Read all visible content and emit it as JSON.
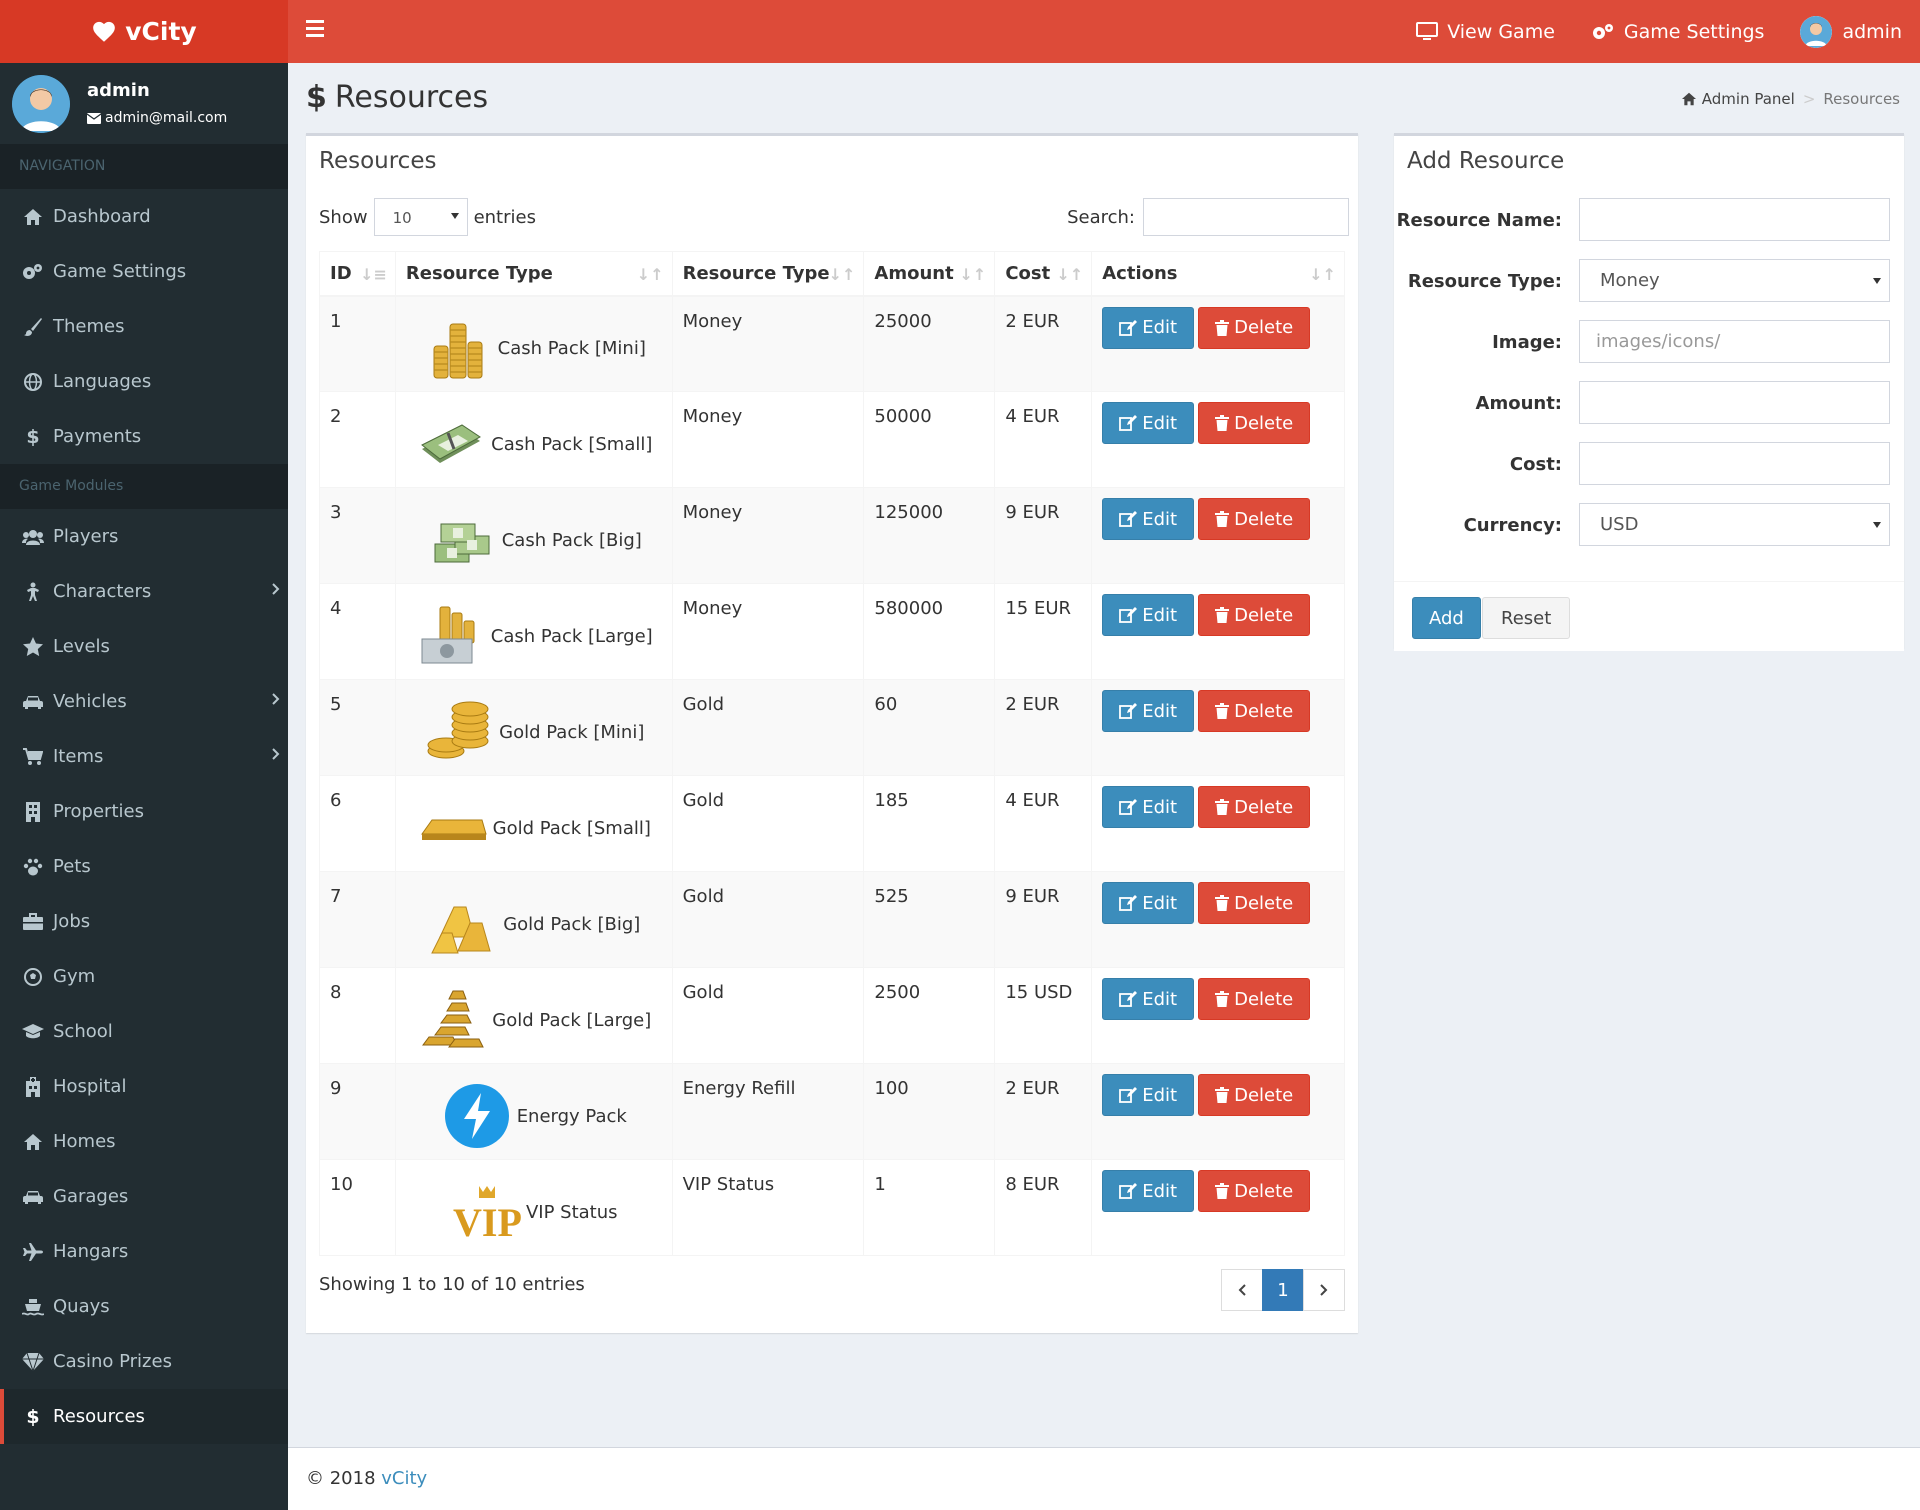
{
  "app": {
    "name": "vCity"
  },
  "topnav": {
    "view_game": "View Game",
    "game_settings": "Game Settings",
    "user": "admin"
  },
  "sidebar": {
    "user_name": "admin",
    "user_email": "admin@mail.com",
    "header_nav": "NAVIGATION",
    "header_modules": "Game Modules",
    "nav": [
      "Dashboard",
      "Game Settings",
      "Themes",
      "Languages",
      "Payments"
    ],
    "modules": [
      "Players",
      "Characters",
      "Levels",
      "Vehicles",
      "Items",
      "Properties",
      "Pets",
      "Jobs",
      "Gym",
      "School",
      "Hospital",
      "Homes",
      "Garages",
      "Hangars",
      "Quays",
      "Casino Prizes",
      "Resources"
    ]
  },
  "page": {
    "title": "Resources"
  },
  "breadcrumb": {
    "home": "Admin Panel",
    "current": "Resources"
  },
  "table_box": {
    "title": "Resources",
    "show": "Show",
    "entries": "entries",
    "page_length": "10",
    "search_label": "Search:",
    "search_value": "",
    "columns": [
      "ID",
      "Resource Type",
      "Resource Type",
      "Amount",
      "Cost",
      "Actions"
    ],
    "edit_label": "Edit",
    "delete_label": "Delete",
    "rows": [
      {
        "id": "1",
        "name": "Cash Pack [Mini]",
        "type": "Money",
        "amount": "25000",
        "cost": "2 EUR",
        "icon": "coin-stacks-icon"
      },
      {
        "id": "2",
        "name": "Cash Pack [Small]",
        "type": "Money",
        "amount": "50000",
        "cost": "4 EUR",
        "icon": "banknote-bundle-icon"
      },
      {
        "id": "3",
        "name": "Cash Pack [Big]",
        "type": "Money",
        "amount": "125000",
        "cost": "9 EUR",
        "icon": "banknote-stacks-icon"
      },
      {
        "id": "4",
        "name": "Cash Pack [Large]",
        "type": "Money",
        "amount": "580000",
        "cost": "15 EUR",
        "icon": "cash-and-coins-icon"
      },
      {
        "id": "5",
        "name": "Gold Pack [Mini]",
        "type": "Gold",
        "amount": "60",
        "cost": "2 EUR",
        "icon": "gold-coins-icon"
      },
      {
        "id": "6",
        "name": "Gold Pack [Small]",
        "type": "Gold",
        "amount": "185",
        "cost": "4 EUR",
        "icon": "gold-bar-icon"
      },
      {
        "id": "7",
        "name": "Gold Pack [Big]",
        "type": "Gold",
        "amount": "525",
        "cost": "9 EUR",
        "icon": "gold-bars-icon"
      },
      {
        "id": "8",
        "name": "Gold Pack [Large]",
        "type": "Gold",
        "amount": "2500",
        "cost": "15 USD",
        "icon": "gold-bar-pile-icon"
      },
      {
        "id": "9",
        "name": "Energy Pack",
        "type": "Energy Refill",
        "amount": "100",
        "cost": "2 EUR",
        "icon": "lightning-bolt-icon"
      },
      {
        "id": "10",
        "name": "VIP Status",
        "type": "VIP Status",
        "amount": "1",
        "cost": "8 EUR",
        "icon": "vip-crown-icon"
      }
    ],
    "info": "Showing 1 to 10 of 10 entries",
    "current_page": "1"
  },
  "form": {
    "title": "Add Resource",
    "name_label": "Resource Name:",
    "name_value": "",
    "type_label": "Resource Type:",
    "type_value": "Money",
    "image_label": "Image:",
    "image_placeholder": "images/icons/",
    "amount_label": "Amount:",
    "amount_value": "",
    "cost_label": "Cost:",
    "cost_value": "",
    "currency_label": "Currency:",
    "currency_value": "USD",
    "add_label": "Add",
    "reset_label": "Reset"
  },
  "footer": {
    "copyright": "© 2018",
    "brand": "vCity"
  },
  "colors": {
    "primary_red": "#dd4b39",
    "sidebar_bg": "#222d32",
    "accent_blue": "#3c8dbc"
  }
}
